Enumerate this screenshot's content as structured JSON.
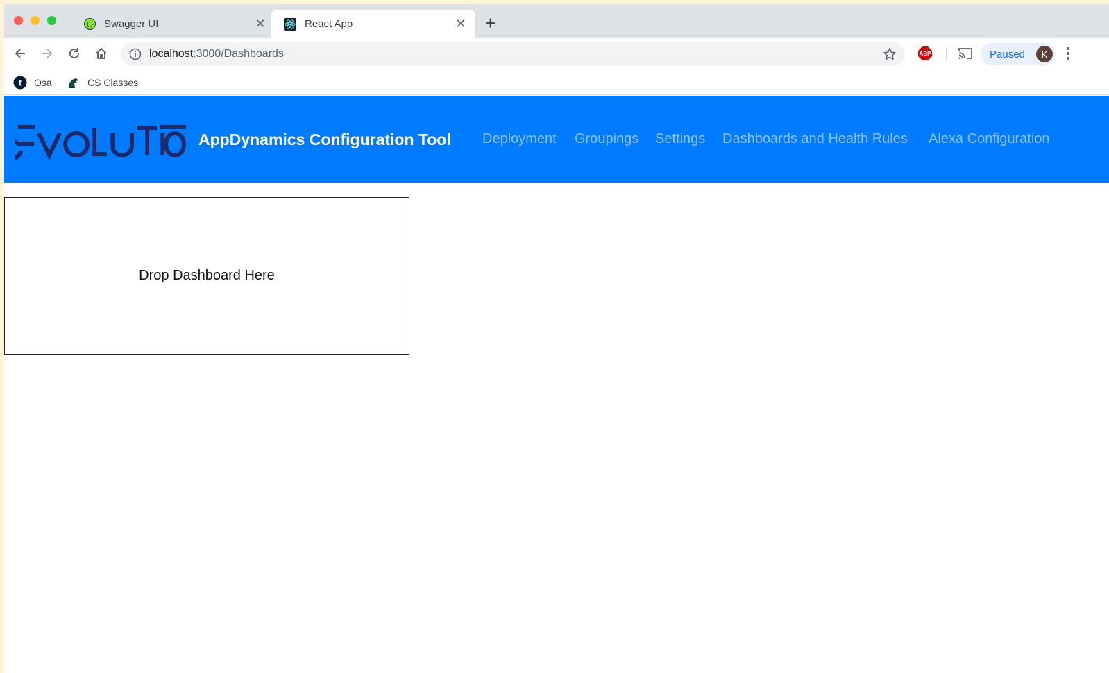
{
  "browser": {
    "tabs": [
      {
        "title": "Swagger UI",
        "favicon": "swagger-icon",
        "active": false
      },
      {
        "title": "React App",
        "favicon": "react-icon",
        "active": true
      }
    ],
    "address": {
      "host": "localhost",
      "path": ":3000/Dashboards"
    },
    "profile": {
      "status": "Paused",
      "initial": "K"
    },
    "extension_label": "ABP",
    "bookmarks": [
      {
        "label": "Osa",
        "icon": "tumblr-icon"
      },
      {
        "label": "CS Classes",
        "icon": "spartan-icon"
      }
    ]
  },
  "app": {
    "logo_text": "ēVOLUTIO",
    "title": "AppDynamics Configuration Tool",
    "nav": [
      "Deployment",
      "Groupings",
      "Settings",
      "Dashboards and Health Rules",
      "Alexa Configuration"
    ],
    "drop_zone_label": "Drop Dashboard Here"
  },
  "colors": {
    "header": "#007bff",
    "logo": "#1a2a6c"
  }
}
